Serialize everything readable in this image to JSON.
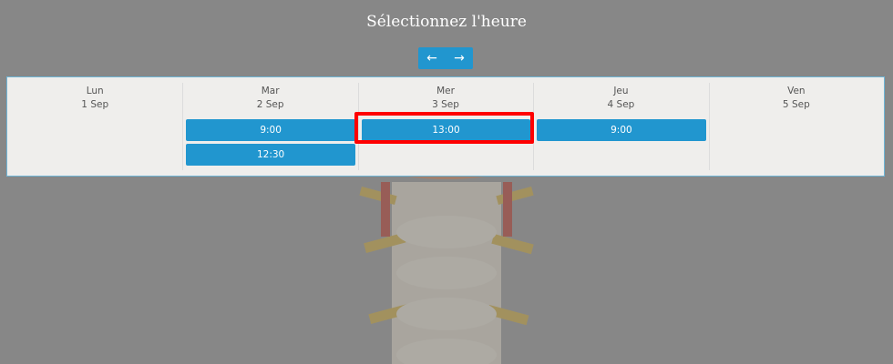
{
  "header": {
    "title": "Sélectionnez l'heure"
  },
  "nav": {
    "prev_icon": "←",
    "next_icon": "→"
  },
  "days": [
    {
      "weekday": "Lun",
      "date": "1 Sep",
      "slots": []
    },
    {
      "weekday": "Mar",
      "date": "2 Sep",
      "slots": [
        "9:00",
        "12:30"
      ]
    },
    {
      "weekday": "Mer",
      "date": "3 Sep",
      "slots": [
        "13:00"
      ]
    },
    {
      "weekday": "Jeu",
      "date": "4 Sep",
      "slots": [
        "9:00"
      ]
    },
    {
      "weekday": "Ven",
      "date": "5 Sep",
      "slots": []
    }
  ],
  "colors": {
    "accent": "#2196cf",
    "highlight": "#ff0000",
    "panel": "#efeeec"
  }
}
